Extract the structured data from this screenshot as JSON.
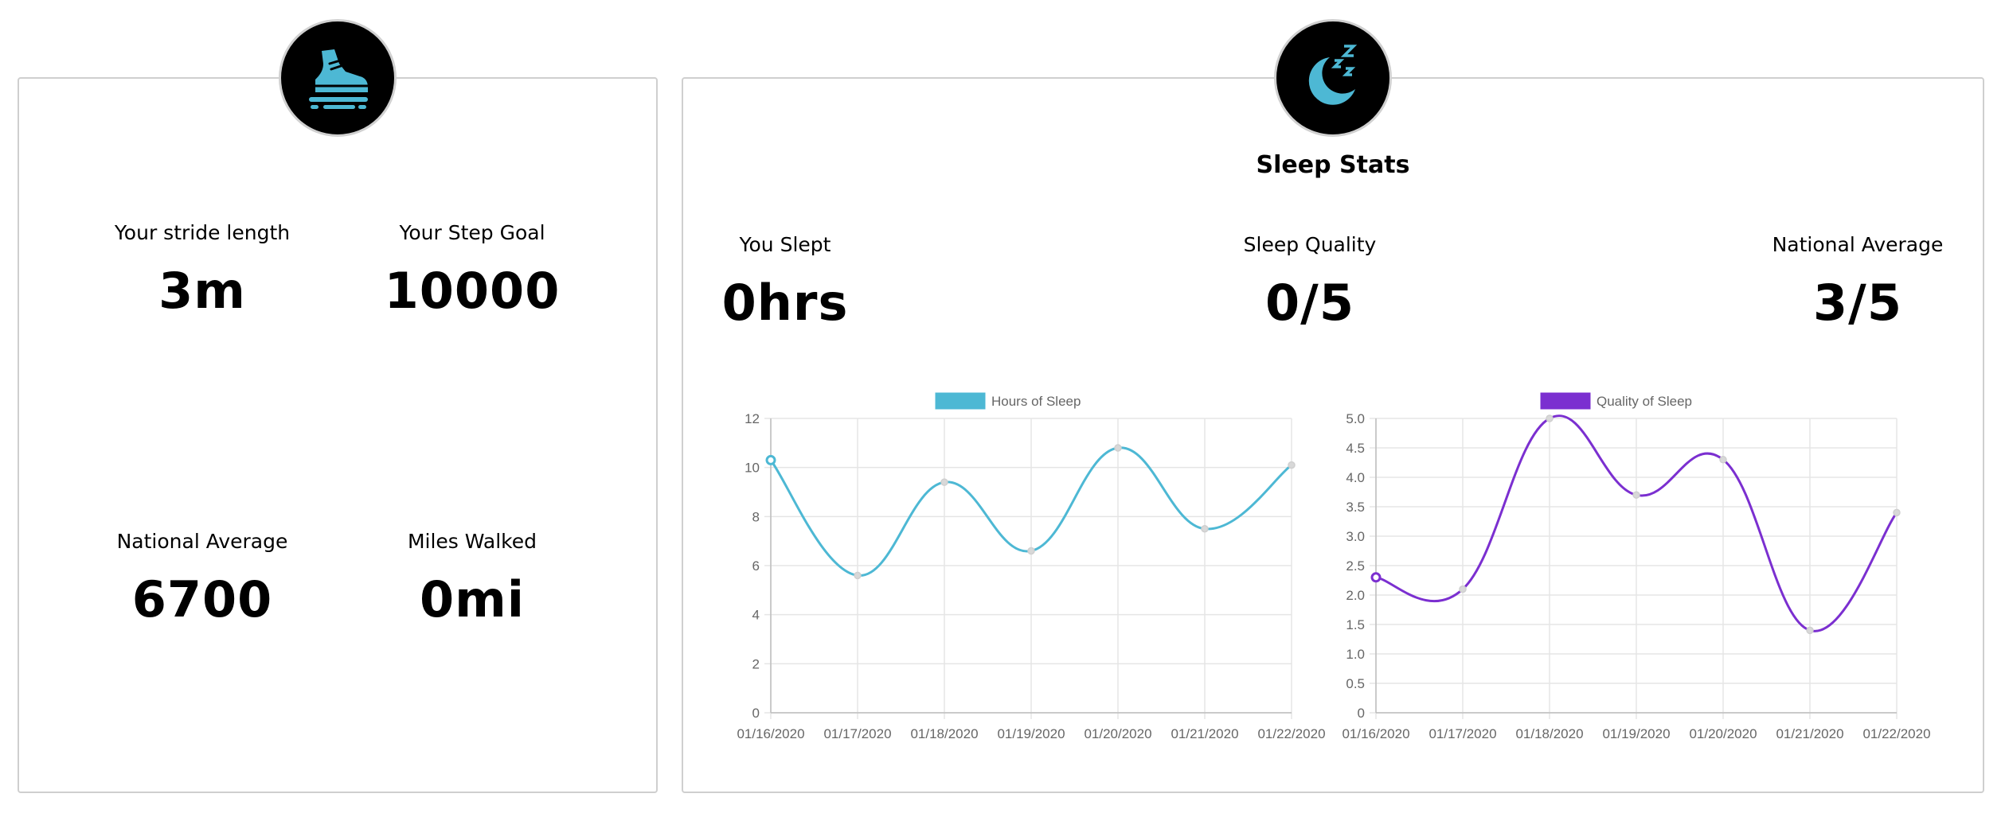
{
  "step_panel": {
    "icon": "shoe-icon",
    "stride": {
      "label": "Your stride length",
      "value": "3m"
    },
    "step_goal": {
      "label": "Your Step Goal",
      "value": "10000"
    },
    "national_average": {
      "label": "National Average",
      "value": "6700"
    },
    "miles_walked": {
      "label": "Miles Walked",
      "value": "0mi"
    }
  },
  "sleep_panel": {
    "icon": "moon-sleep-icon",
    "title": "Sleep Stats",
    "you_slept": {
      "label": "You Slept",
      "value": "0hrs"
    },
    "sleep_quality": {
      "label": "Sleep Quality",
      "value": "0/5"
    },
    "national_average": {
      "label": "National Average",
      "value": "3/5"
    }
  },
  "colors": {
    "hours_line": "#4db8d4",
    "quality_line": "#7b2fd0",
    "icon_accent": "#4db8d4"
  },
  "chart_data": [
    {
      "type": "line",
      "legend": "Hours of Sleep",
      "categories": [
        "01/16/2020",
        "01/17/2020",
        "01/18/2020",
        "01/19/2020",
        "01/20/2020",
        "01/21/2020",
        "01/22/2020"
      ],
      "values": [
        10.3,
        5.6,
        9.4,
        6.6,
        10.8,
        7.5,
        10.1
      ],
      "ylim": [
        0,
        12
      ],
      "yticks": [
        "0",
        "2",
        "4",
        "6",
        "8",
        "10",
        "12"
      ],
      "grid": true,
      "legend_position": "top"
    },
    {
      "type": "line",
      "legend": "Quality of Sleep",
      "categories": [
        "01/16/2020",
        "01/17/2020",
        "01/18/2020",
        "01/19/2020",
        "01/20/2020",
        "01/21/2020",
        "01/22/2020"
      ],
      "values": [
        2.3,
        2.1,
        5.0,
        3.7,
        4.3,
        1.4,
        3.4
      ],
      "ylim": [
        0,
        5
      ],
      "yticks": [
        "0",
        "0.5",
        "1.0",
        "1.5",
        "2.0",
        "2.5",
        "3.0",
        "3.5",
        "4.0",
        "4.5",
        "5.0"
      ],
      "grid": true,
      "legend_position": "top"
    }
  ]
}
